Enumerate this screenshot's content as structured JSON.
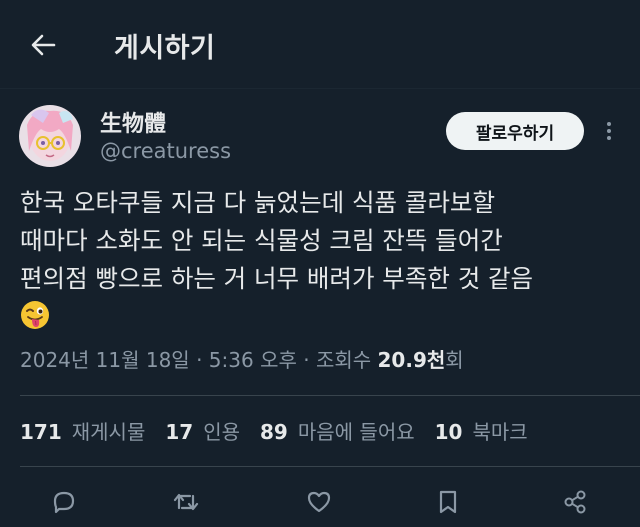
{
  "header": {
    "title": "게시하기",
    "back_icon": "arrow-left-icon"
  },
  "author": {
    "display_name": "生物體",
    "handle": "@creaturess",
    "follow_label": "팔로우하기"
  },
  "tweet": {
    "lines": [
      "한국 오타쿠들 지금 다 늙었는데 식품 콜라보할",
      "때마다 소화도 안 되는 식물성 크림 잔뜩 들어간",
      "편의점 빵으로 하는 거 너무 배려가 부족한 것 같음"
    ],
    "emoji": "winking-face-with-tongue"
  },
  "meta": {
    "date": "2024년 11월 18일",
    "sep1": " · ",
    "time": "5:36 오후",
    "sep2": " · ",
    "views_label": "조회수 ",
    "views_count": "20.9천",
    "views_suffix": "회"
  },
  "stats": {
    "reposts": {
      "count": "171",
      "label": "재게시물"
    },
    "quotes": {
      "count": "17",
      "label": "인용"
    },
    "likes": {
      "count": "89",
      "label": "마음에 들어요"
    },
    "bookmarks": {
      "count": "10",
      "label": "북마크"
    }
  },
  "actions": [
    "reply-icon",
    "retweet-icon",
    "like-icon",
    "bookmark-icon",
    "share-icon"
  ],
  "colors": {
    "background": "#15202b",
    "text_primary": "#e7e9ea",
    "text_secondary": "#8b98a5",
    "divider": "#38444d",
    "follow_button_bg": "#eff3f4"
  }
}
